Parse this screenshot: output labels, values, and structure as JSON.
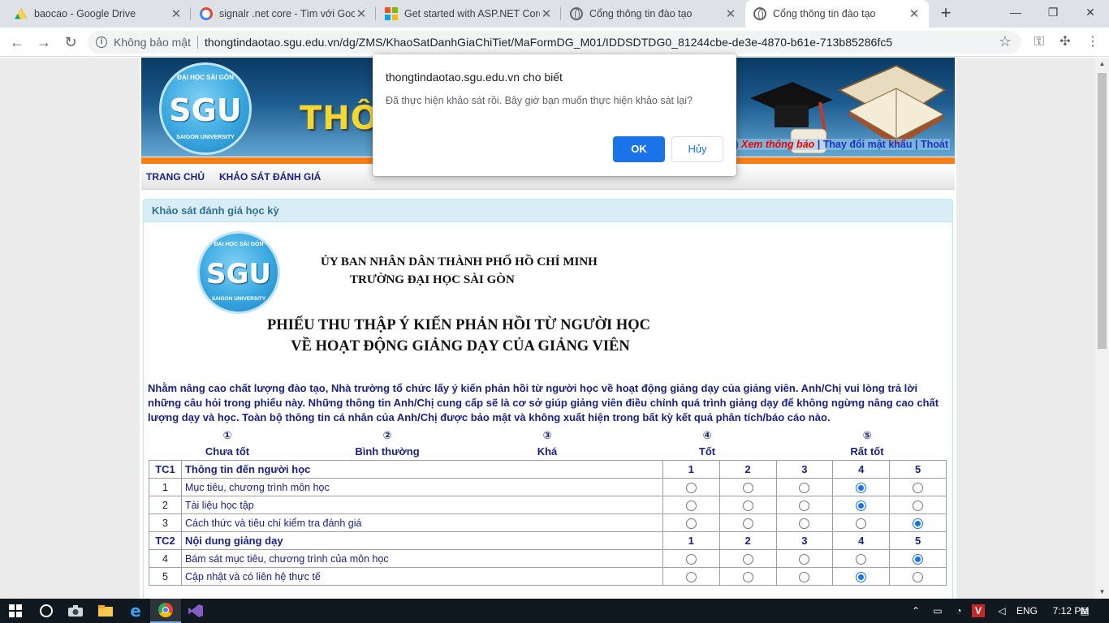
{
  "browser": {
    "tabs": [
      {
        "title": "baocao - Google Drive",
        "icon": "google-drive-icon",
        "active": false
      },
      {
        "title": "signalr .net core - Tìm với Google",
        "icon": "google-icon",
        "active": false
      },
      {
        "title": "Get started with ASP.NET Core",
        "icon": "microsoft-icon",
        "active": false
      },
      {
        "title": "Cổng thông tin đào tạo",
        "icon": "globe-icon",
        "active": false
      },
      {
        "title": "Cổng thông tin đào tạo",
        "icon": "globe-icon",
        "active": true
      }
    ],
    "security_label": "Không bảo mật",
    "url": "thongtindaotao.sgu.edu.vn/dg/ZMS/KhaoSatDanhGiaChiTiet/MaFormDG_M01/IDDSDTDG0_81244cbe-de3e-4870-b61e-713b85286fc5"
  },
  "header": {
    "banner_title": "THÔ",
    "logo_text": "SGU",
    "logo_ring_top": "ĐẠI HỌC SÀI GÒN",
    "logo_ring_bottom": "SAIGON UNIVERSITY",
    "notice_count": "4)",
    "notice_link": "Xem thông báo",
    "change_password": "Thay đổi mật khẩu",
    "logout": "Thoát"
  },
  "menu": {
    "home": "TRANG CHỦ",
    "survey": "KHẢO SÁT ĐÁNH GIÁ"
  },
  "panel": {
    "title": "Khảo sát đánh giá học kỳ",
    "org_line1": "ỦY BAN NHÂN DÂN THÀNH PHỐ HỒ CHÍ MINH",
    "org_line2": "TRƯỜNG ĐẠI HỌC SÀI GÒN",
    "form_title1": "PHIẾU THU THẬP Ý KIẾN PHẢN HỒI TỪ NGƯỜI HỌC",
    "form_title2": "VỀ HOẠT ĐỘNG GIẢNG DẠY CỦA GIẢNG VIÊN",
    "intro": "Nhằm nâng cao chất lượng đào tạo, Nhà trường tổ chức lấy ý kiến phản hồi từ người học về hoạt động giảng dạy của giảng viên. Anh/Chị vui lòng trả lời những câu hỏi trong phiếu này. Những thông tin Anh/Chị cung cấp sẽ là cơ sở giúp giảng viên điều chỉnh quá trình giảng dạy để không ngừng nâng cao chất lượng dạy và học. Toàn bộ thông tin cá nhân của Anh/Chị được bảo mật và không xuất hiện trong bất kỳ kết quả phân tích/báo cáo nào."
  },
  "scale": [
    {
      "num": "①",
      "label": "Chưa tốt"
    },
    {
      "num": "②",
      "label": "Bình thường"
    },
    {
      "num": "③",
      "label": "Khá"
    },
    {
      "num": "④",
      "label": "Tốt"
    },
    {
      "num": "⑤",
      "label": "Rất tốt"
    }
  ],
  "survey": {
    "rating_headers": [
      "1",
      "2",
      "3",
      "4",
      "5"
    ],
    "groups": [
      {
        "code": "TC1",
        "title": "Thông tin đến người học",
        "items": [
          {
            "no": "1",
            "text": "Mục tiêu, chương trình môn học",
            "selected": 4
          },
          {
            "no": "2",
            "text": "Tài liệu học tập",
            "selected": 4
          },
          {
            "no": "3",
            "text": "Cách thức và tiêu chí kiểm tra đánh giá",
            "selected": 5
          }
        ]
      },
      {
        "code": "TC2",
        "title": "Nội dung giảng dạy",
        "items": [
          {
            "no": "4",
            "text": "Bám sát mục tiêu, chương trình của môn học",
            "selected": 5
          },
          {
            "no": "5",
            "text": "Cập nhật và có liên hệ thực tế",
            "selected": 4
          }
        ]
      }
    ]
  },
  "dialog": {
    "title": "thongtindaotao.sgu.edu.vn cho biết",
    "message": "Đã thực hiện khảo sát rồi. Bây giờ bạn muốn thực hiện khảo sát lại?",
    "ok": "OK",
    "cancel": "Hủy"
  },
  "taskbar": {
    "language": "ENG",
    "time": "7:12 PM"
  }
}
